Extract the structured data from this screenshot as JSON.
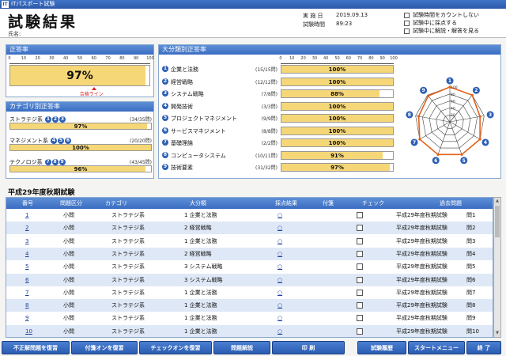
{
  "window": {
    "title": "ITパスポート試験"
  },
  "header": {
    "title": "試験結果",
    "name_label": "氏名:",
    "date_label": "実 施 日",
    "date_value": "2019.09.13",
    "time_label": "試験時間",
    "time_value": "89:23",
    "options": [
      "試験時間をカウントしない",
      "試験中に採点する",
      "試験中に解説・解答を見る"
    ]
  },
  "overall": {
    "title": "正答率",
    "scale": [
      "0",
      "10",
      "20",
      "30",
      "40",
      "50",
      "60",
      "70",
      "80",
      "90",
      "100"
    ],
    "value_text": "97%",
    "value": 97,
    "pass_line": 60,
    "pass_label": "合格ライン"
  },
  "category": {
    "title": "カテゴリ別正答率",
    "rows": [
      {
        "name": "ストラテジ系",
        "nums": [
          "1",
          "2",
          "3"
        ],
        "score": "(34/35問)",
        "pct_text": "97%",
        "pct": 97
      },
      {
        "name": "マネジメント系",
        "nums": [
          "4",
          "5",
          "6"
        ],
        "score": "(20/20問)",
        "pct_text": "100%",
        "pct": 100
      },
      {
        "name": "テクノロジ系",
        "nums": [
          "7",
          "8",
          "9"
        ],
        "score": "(43/45問)",
        "pct_text": "96%",
        "pct": 96
      }
    ]
  },
  "major": {
    "title": "大分類別正答率",
    "scale": [
      "0",
      "10",
      "20",
      "30",
      "40",
      "50",
      "60",
      "70",
      "80",
      "90",
      "100"
    ],
    "rows": [
      {
        "num": "1",
        "name": "企業と法務",
        "score": "(15/15問)",
        "pct_text": "100%",
        "pct": 100
      },
      {
        "num": "2",
        "name": "経営戦略",
        "score": "(12/12問)",
        "pct_text": "100%",
        "pct": 100
      },
      {
        "num": "3",
        "name": "システム戦略",
        "score": "(7/8問)",
        "pct_text": "88%",
        "pct": 88
      },
      {
        "num": "4",
        "name": "開発技術",
        "score": "(3/3問)",
        "pct_text": "100%",
        "pct": 100
      },
      {
        "num": "5",
        "name": "プロジェクトマネジメント",
        "score": "(9/9問)",
        "pct_text": "100%",
        "pct": 100
      },
      {
        "num": "6",
        "name": "サービスマネジメント",
        "score": "(8/8問)",
        "pct_text": "100%",
        "pct": 100
      },
      {
        "num": "7",
        "name": "基礎理論",
        "score": "(2/2問)",
        "pct_text": "100%",
        "pct": 100
      },
      {
        "num": "8",
        "name": "コンピュータシステム",
        "score": "(10/11問)",
        "pct_text": "91%",
        "pct": 91
      },
      {
        "num": "9",
        "name": "技術要素",
        "score": "(31/32問)",
        "pct_text": "97%",
        "pct": 97
      }
    ],
    "radar_scale": [
      "100",
      "80",
      "60",
      "40",
      "20"
    ]
  },
  "table": {
    "title": "平成29年度秋期試験",
    "headers": [
      "番号",
      "問題区分",
      "カテゴリ",
      "大分類",
      "採点結果",
      "付箋",
      "チェック",
      "過去問題"
    ],
    "rows": [
      {
        "no": "1",
        "kubun": "小問",
        "cat": "ストラテジ系",
        "major": "1 企業と法務",
        "result": "○",
        "past": "平成29年度秋期試験",
        "q": "問1"
      },
      {
        "no": "2",
        "kubun": "小問",
        "cat": "ストラテジ系",
        "major": "2 経営戦略",
        "result": "○",
        "past": "平成29年度秋期試験",
        "q": "問2"
      },
      {
        "no": "3",
        "kubun": "小問",
        "cat": "ストラテジ系",
        "major": "1 企業と法務",
        "result": "○",
        "past": "平成29年度秋期試験",
        "q": "問3"
      },
      {
        "no": "4",
        "kubun": "小問",
        "cat": "ストラテジ系",
        "major": "2 経営戦略",
        "result": "○",
        "past": "平成29年度秋期試験",
        "q": "問4"
      },
      {
        "no": "5",
        "kubun": "小問",
        "cat": "ストラテジ系",
        "major": "3 システム戦略",
        "result": "○",
        "past": "平成29年度秋期試験",
        "q": "問5"
      },
      {
        "no": "6",
        "kubun": "小問",
        "cat": "ストラテジ系",
        "major": "3 システム戦略",
        "result": "○",
        "past": "平成29年度秋期試験",
        "q": "問6"
      },
      {
        "no": "7",
        "kubun": "小問",
        "cat": "ストラテジ系",
        "major": "1 企業と法務",
        "result": "○",
        "past": "平成29年度秋期試験",
        "q": "問7"
      },
      {
        "no": "8",
        "kubun": "小問",
        "cat": "ストラテジ系",
        "major": "1 企業と法務",
        "result": "○",
        "past": "平成29年度秋期試験",
        "q": "問8"
      },
      {
        "no": "9",
        "kubun": "小問",
        "cat": "ストラテジ系",
        "major": "1 企業と法務",
        "result": "○",
        "past": "平成29年度秋期試験",
        "q": "問9"
      },
      {
        "no": "10",
        "kubun": "小問",
        "cat": "ストラテジ系",
        "major": "1 企業と法務",
        "result": "○",
        "past": "平成29年度秋期試験",
        "q": "問10"
      }
    ]
  },
  "footer": {
    "buttons": [
      "不正解問題を復習",
      "付箋オンを復習",
      "チェックオンを復習",
      "問題解説",
      "印 刷",
      "試験履歴",
      "スタートメニュー",
      "終 了"
    ]
  },
  "colors": {
    "accent": "#3a6cc2",
    "bar": "#f6d777",
    "radar": "#e2611b",
    "pass": "#d22222"
  }
}
